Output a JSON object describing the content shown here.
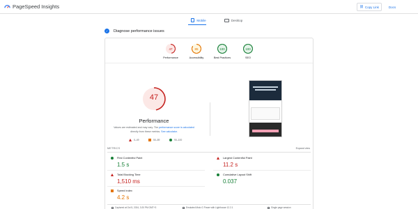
{
  "app": {
    "title": "PageSpeed Insights"
  },
  "header": {
    "copy_link_label": "Copy Link",
    "docs_label": "Docs"
  },
  "tabs": [
    {
      "label": "Mobile",
      "active": true
    },
    {
      "label": "Desktop",
      "active": false
    }
  ],
  "diagnose": {
    "title": "Diagnose performance issues"
  },
  "scores": [
    {
      "value": "47",
      "label": "Performance",
      "status": "fail",
      "fraction": 0.47
    },
    {
      "value": "85",
      "label": "Accessibility",
      "status": "average",
      "fraction": 0.85
    },
    {
      "value": "100",
      "label": "Best Practices",
      "status": "pass",
      "fraction": 1.0
    },
    {
      "value": "100",
      "label": "SEO",
      "status": "pass",
      "fraction": 1.0
    }
  ],
  "performance": {
    "score": "47",
    "fraction": 0.47,
    "title": "Performance",
    "note_part1": "Values are estimated and may vary. The ",
    "note_link1": "performance score is calculated",
    "note_part2": " directly from these metrics. ",
    "note_link2": "See calculator.",
    "legend": [
      "0–49",
      "50–89",
      "90–100"
    ]
  },
  "metrics": {
    "section_label": "METRICS",
    "expand_label": "Expand view",
    "items": [
      {
        "name": "First Contentful Paint",
        "value": "1.5 s",
        "status": "pass"
      },
      {
        "name": "Largest Contentful Paint",
        "value": "11.2 s",
        "status": "fail"
      },
      {
        "name": "Total Blocking Time",
        "value": "1,510 ms",
        "status": "fail"
      },
      {
        "name": "Cumulative Layout Shift",
        "value": "0.037",
        "status": "pass"
      },
      {
        "name": "Speed Index",
        "value": "4.2 s",
        "status": "average"
      }
    ]
  },
  "footer": {
    "captured": "Captured at Oct 5, 2024, 3:20 PM GMT+3",
    "emulated": "Emulated Moto G Power with Lighthouse 12.2.1",
    "session": "Single page session"
  },
  "colors": {
    "fail": "#c5221f",
    "average": "#e37400",
    "pass": "#188038",
    "accent": "#1a73e8"
  }
}
